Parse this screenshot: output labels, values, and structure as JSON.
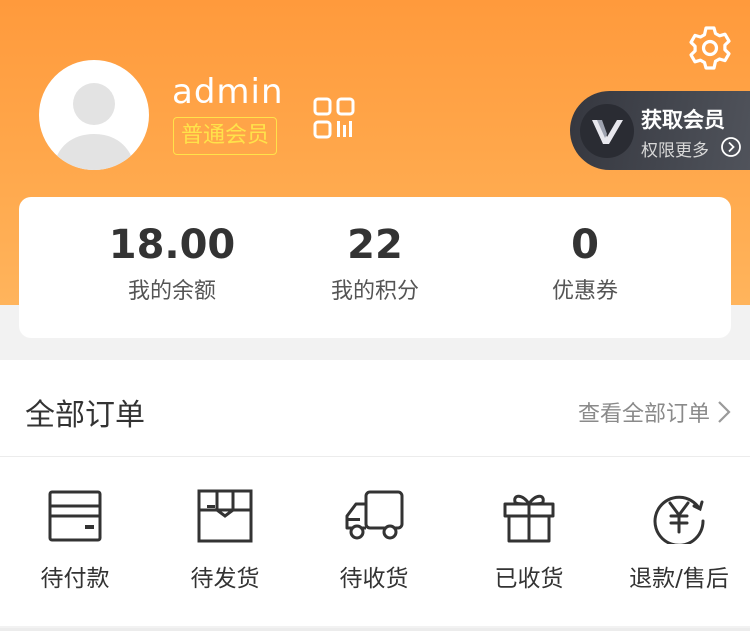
{
  "user": {
    "name": "admin",
    "membership": "普通会员"
  },
  "vip_card": {
    "title": "获取会员",
    "subtitle": "权限更多"
  },
  "stats": [
    {
      "value": "18.00",
      "label": "我的余额"
    },
    {
      "value": "22",
      "label": "我的积分"
    },
    {
      "value": "0",
      "label": "优惠券"
    }
  ],
  "orders": {
    "title": "全部订单",
    "view_all": "查看全部订单",
    "items": [
      {
        "label": "待付款",
        "icon": "wallet-icon"
      },
      {
        "label": "待发货",
        "icon": "package-icon"
      },
      {
        "label": "待收货",
        "icon": "truck-icon"
      },
      {
        "label": "已收货",
        "icon": "gift-icon"
      },
      {
        "label": "退款/售后",
        "icon": "refund-icon"
      }
    ]
  },
  "colors": {
    "header_orange": "#ffa84c",
    "badge_yellow": "#ffe24a",
    "vip_dark": "#3c3e46"
  }
}
